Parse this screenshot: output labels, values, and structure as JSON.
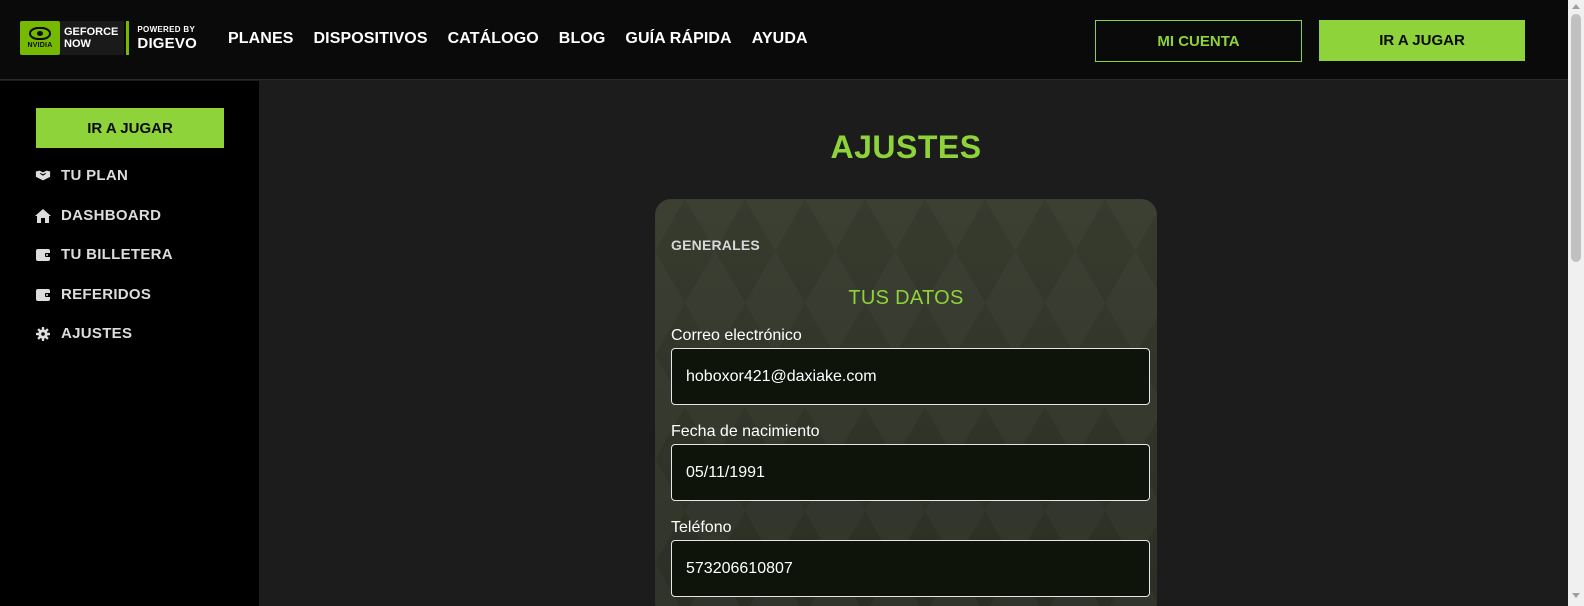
{
  "header": {
    "logo": {
      "nvidia_text": "NVIDIA",
      "geforce_line1": "GEFORCE",
      "geforce_line2": "NOW",
      "powered_by": "POWERED BY",
      "brand": "DIGEVO"
    },
    "nav": [
      {
        "label": "PLANES"
      },
      {
        "label": "DISPOSITIVOS"
      },
      {
        "label": "CATÁLOGO"
      },
      {
        "label": "BLOG"
      },
      {
        "label": "GUÍA RÁPIDA"
      },
      {
        "label": "AYUDA"
      }
    ],
    "account_button": "MI CUENTA",
    "play_button": "IR A JUGAR"
  },
  "sidebar": {
    "play_button": "IR A JUGAR",
    "items": [
      {
        "label": "TU PLAN",
        "icon": "handshake-icon"
      },
      {
        "label": "DASHBOARD",
        "icon": "home-icon"
      },
      {
        "label": "TU BILLETERA",
        "icon": "wallet-icon"
      },
      {
        "label": "REFERIDOS",
        "icon": "wallet-icon"
      },
      {
        "label": "AJUSTES",
        "icon": "gear-icon"
      }
    ]
  },
  "main": {
    "title": "AJUSTES",
    "section_label": "GENERALES",
    "card_title": "TUS DATOS",
    "fields": [
      {
        "label": "Correo electrónico",
        "value": "hoboxor421@daxiake.com"
      },
      {
        "label": "Fecha de nacimiento",
        "value": "05/11/1991"
      },
      {
        "label": "Teléfono",
        "value": "573206610807"
      }
    ]
  },
  "colors": {
    "accent": "#8fd33a",
    "header_bg": "#0a0a0a",
    "sidebar_bg": "#000000",
    "content_bg": "#1c1c1c",
    "card_bg": "#2e3226",
    "input_bg": "#0f140b"
  }
}
